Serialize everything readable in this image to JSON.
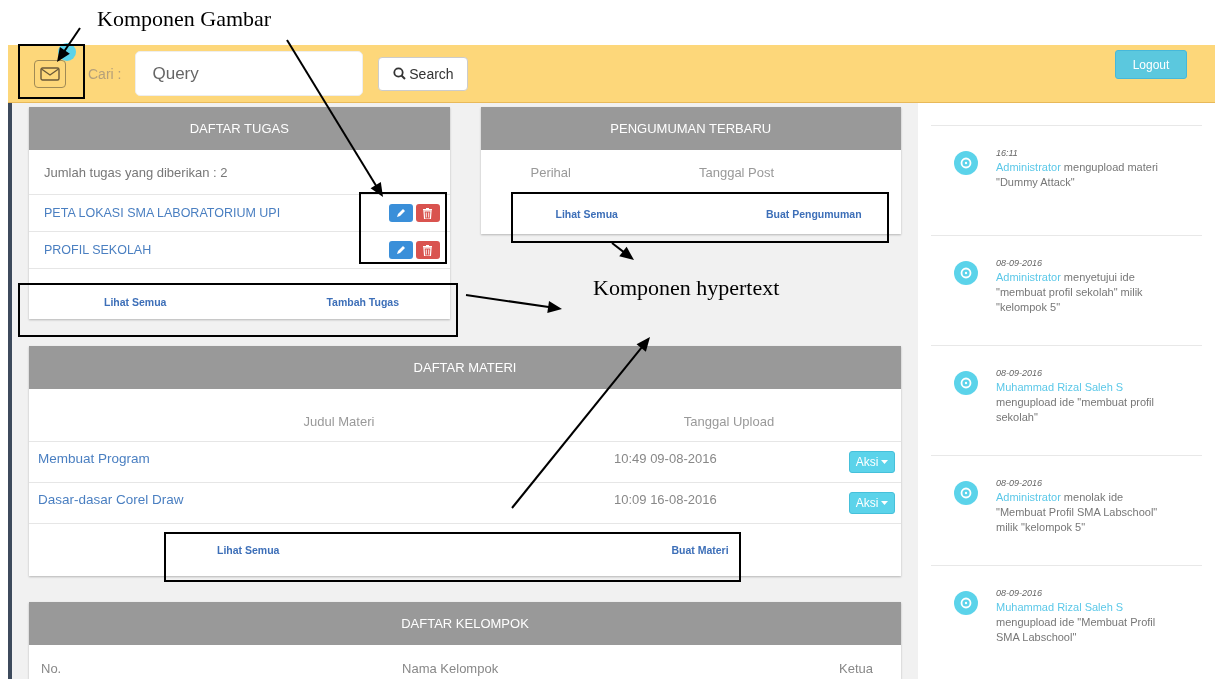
{
  "annotations": [
    {
      "text": "Komponen Gambar"
    },
    {
      "text": "Komponen hypertext"
    }
  ],
  "header": {
    "search_label": "Cari :",
    "search_placeholder": "Query",
    "search_button": "Search",
    "logout_button": "Logout"
  },
  "daftar_tugas": {
    "title": "DAFTAR TUGAS",
    "summary": "Jumlah tugas yang diberikan : 2",
    "rows": [
      {
        "title": "PETA LOKASI SMA LABORATORIUM UPI"
      },
      {
        "title": "PROFIL SEKOLAH"
      }
    ],
    "links": [
      "Lihat Semua",
      "Tambah Tugas"
    ]
  },
  "pengumuman": {
    "title": "PENGUMUMAN TERBARU",
    "columns": [
      "Perihal",
      "Tanggal Post"
    ],
    "links": [
      "Lihat Semua",
      "Buat Pengumuman"
    ]
  },
  "daftar_materi": {
    "title": "DAFTAR MATERI",
    "columns": [
      "Judul Materi",
      "Tanggal Upload"
    ],
    "rows": [
      {
        "title": "Membuat Program",
        "date": "10:49 09-08-2016",
        "action": "Aksi"
      },
      {
        "title": "Dasar-dasar Corel Draw",
        "date": "10:09 16-08-2016",
        "action": "Aksi"
      }
    ],
    "links": [
      "Lihat Semua",
      "Buat Materi"
    ]
  },
  "daftar_kelompok": {
    "title": "DAFTAR KELOMPOK",
    "columns": [
      "No.",
      "Nama Kelompok",
      "Ketua"
    ]
  },
  "activity": [
    {
      "time": "16:11",
      "actor": "Administrator",
      "text": " mengupload materi \"Dummy Attack\""
    },
    {
      "time": "08-09-2016",
      "actor": "Administrator",
      "text": " menyetujui ide \"membuat profil sekolah\" milik \"kelompok 5\""
    },
    {
      "time": "08-09-2016",
      "actor": "Muhammad Rizal Saleh S",
      "text": " mengupload ide \"membuat profil sekolah\""
    },
    {
      "time": "08-09-2016",
      "actor": "Administrator",
      "text": " menolak ide \"Membuat Profil SMA Labschool\" milik \"kelompok 5\""
    },
    {
      "time": "08-09-2016",
      "actor": "Muhammad Rizal Saleh S",
      "text": " mengupload ide \"Membuat Profil SMA Labschool\""
    }
  ]
}
